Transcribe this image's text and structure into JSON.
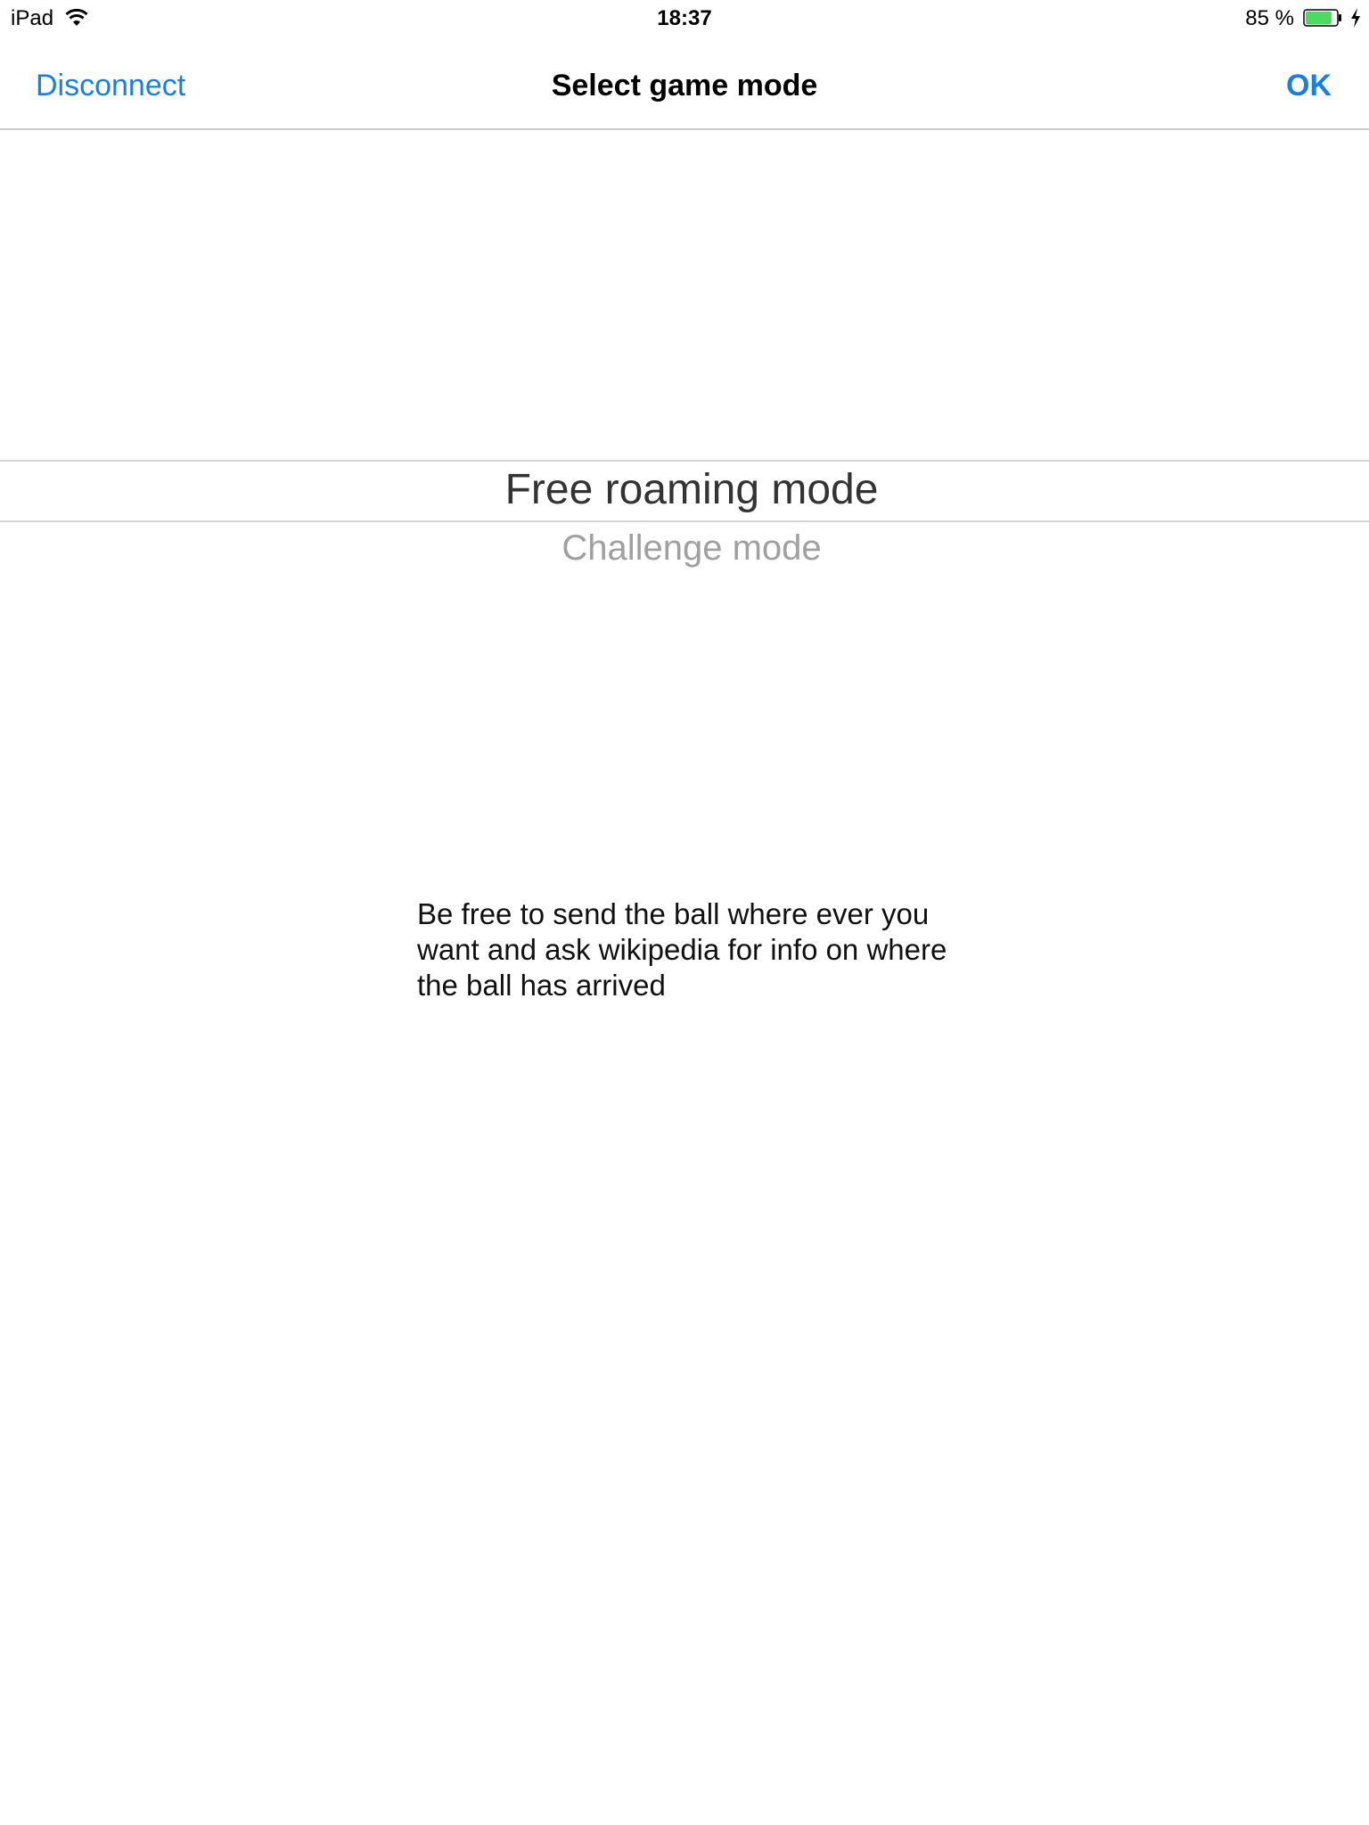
{
  "status_bar": {
    "device": "iPad",
    "wifi_icon": "wifi-icon",
    "time": "18:37",
    "battery_percent": "85 %",
    "battery_level": 0.85,
    "battery_icon": "battery-icon",
    "charging_icon": "bolt-icon",
    "battery_color": "#4cd964"
  },
  "nav": {
    "left_button": "Disconnect",
    "title": "Select game mode",
    "right_button": "OK",
    "accent_color": "#1a7fe0"
  },
  "picker": {
    "options": [
      "Free roaming mode",
      "Challenge mode"
    ],
    "selected": "Free roaming mode"
  },
  "description": "Be free to send the ball where ever you want and ask wikipedia for info on where the ball has arrived"
}
